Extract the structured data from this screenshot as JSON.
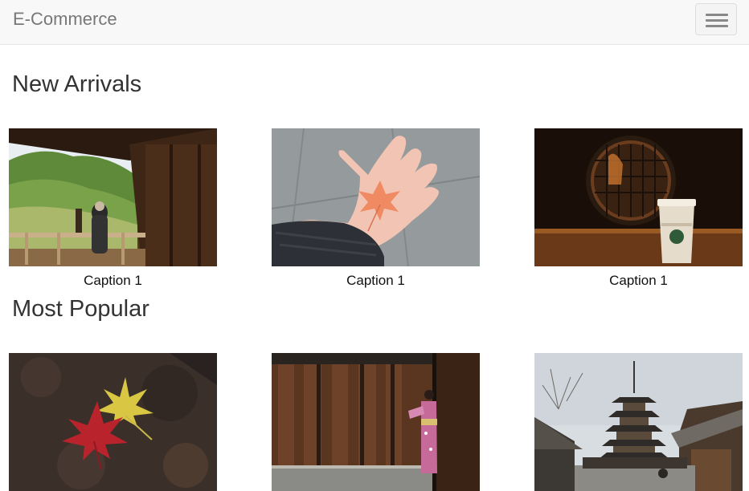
{
  "navbar": {
    "brand": "E-Commerce",
    "menu_icon": "hamburger-menu-icon"
  },
  "sections": [
    {
      "title": "New Arrivals",
      "items": [
        {
          "caption": "Caption 1",
          "image": "temple-veranda-monk-photo"
        },
        {
          "caption": "Caption 1",
          "image": "hand-holding-maple-leaf-photo"
        },
        {
          "caption": "Caption 1",
          "image": "round-window-coffee-cup-photo"
        }
      ]
    },
    {
      "title": "Most Popular",
      "items": [
        {
          "caption": "",
          "image": "autumn-leaves-on-stone-photo"
        },
        {
          "caption": "",
          "image": "kimono-wooden-wall-photo"
        },
        {
          "caption": "",
          "image": "pagoda-street-photo"
        }
      ]
    }
  ],
  "colors": {
    "navbar_bg": "#f8f8f8",
    "brand": "#777777",
    "text": "#333333"
  }
}
